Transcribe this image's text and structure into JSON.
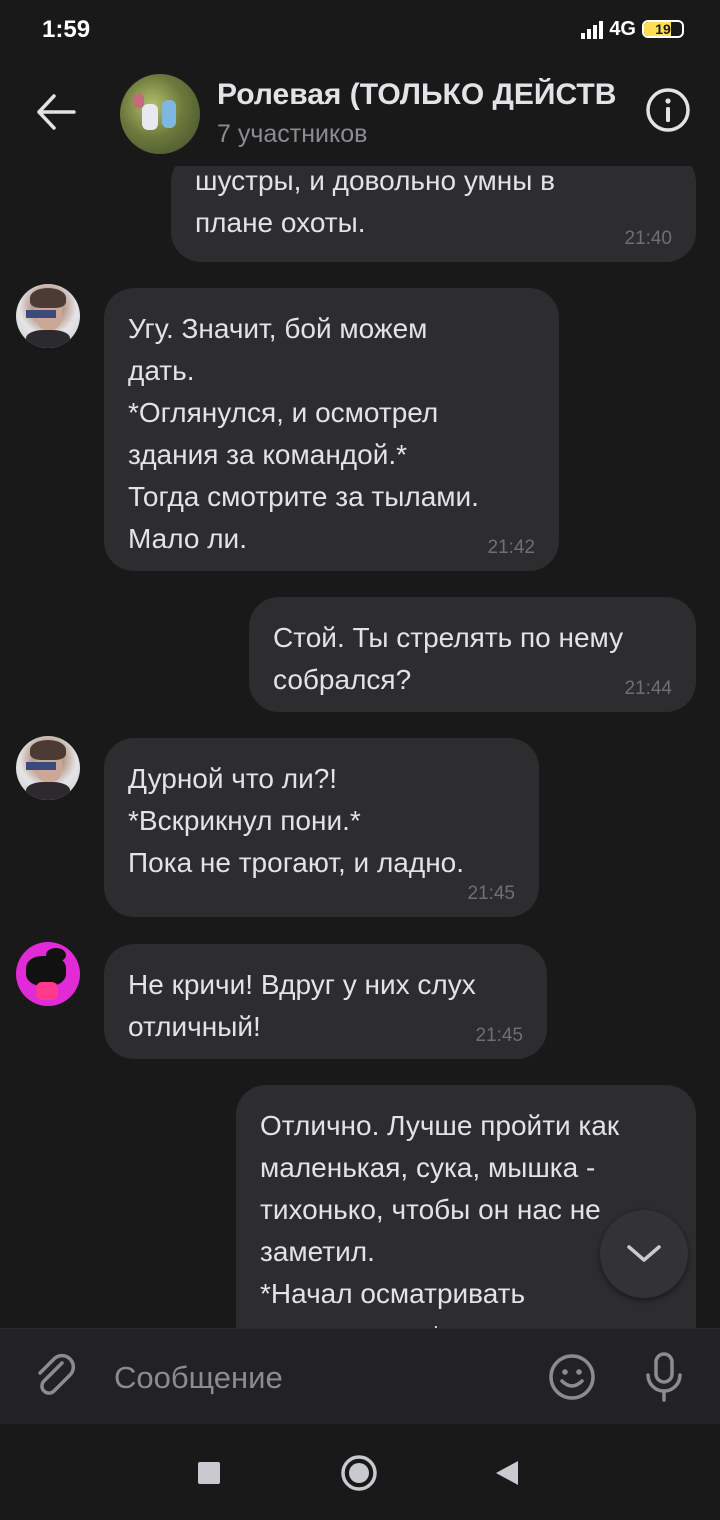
{
  "status_bar": {
    "time": "1:59",
    "network": "4G",
    "battery": "19"
  },
  "header": {
    "title": "Ролевая (ТОЛЬКО ДЕЙСТВ",
    "subtitle": "7 участников",
    "icons": {
      "back": "arrow-left-icon",
      "info": "info-icon"
    }
  },
  "messages": [
    {
      "side": "out",
      "text": "шустры, и довольно умны в\nплане охоты.",
      "time": "21:40"
    },
    {
      "side": "in",
      "avatar": "boy",
      "text": "Угу. Значит, бой можем\nдать.\n*Оглянулся, и осмотрел\nздания за командой.*\nТогда смотрите за тылами.\nМало ли.",
      "time": "21:42"
    },
    {
      "side": "out",
      "text": "Стой. Ты стрелять по нему\nсобрался?",
      "time": "21:44"
    },
    {
      "side": "in",
      "avatar": "boy",
      "text": "Дурной что ли?!\n*Вскрикнул пони.*\nПока не трогают, и ладно.",
      "time": "21:45"
    },
    {
      "side": "in",
      "avatar": "pink",
      "text": "Не кричи! Вдруг у них слух\nотличный!",
      "time": "21:45"
    },
    {
      "side": "out",
      "text": "Отлично. Лучше пройти как\nмаленькая, сука, мышка -\nтихонько, чтобы он нас не\nзаметил.\n*Начал осматривать\nповерхность.*",
      "time": ""
    }
  ],
  "composer": {
    "placeholder": "Сообщение",
    "icons": {
      "attach": "paperclip-icon",
      "emoji": "emoji-icon",
      "mic": "microphone-icon"
    }
  },
  "scroll_button": {
    "icon": "chevron-down-icon"
  },
  "nav_bar": {
    "icons": [
      "square-icon",
      "circle-icon",
      "triangle-back-icon"
    ]
  },
  "colors": {
    "background": "#19191a",
    "bubble": "#2d2d2f",
    "text": "#e1e3e6",
    "secondary_text": "#8a8c91",
    "timestamp": "#6d6f73"
  }
}
